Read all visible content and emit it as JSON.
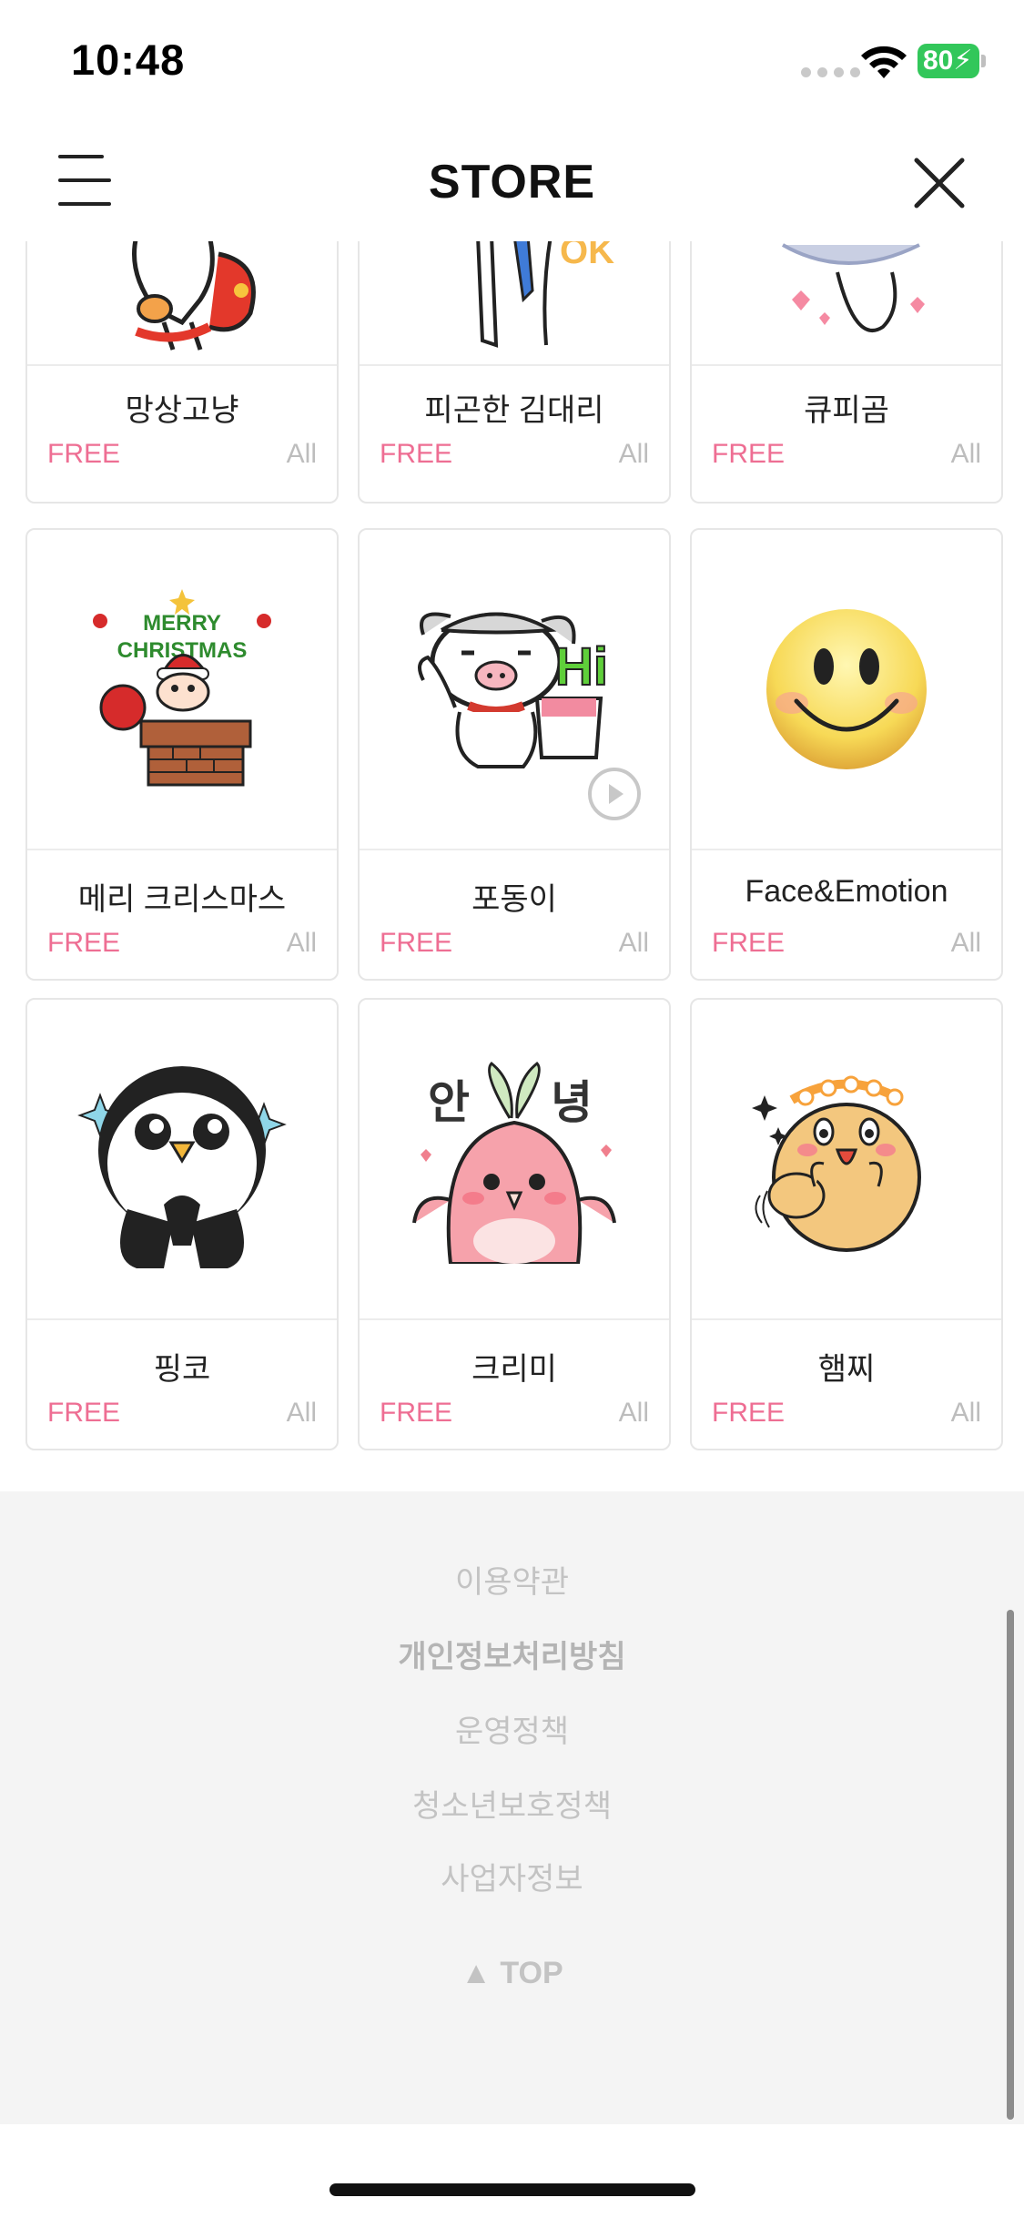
{
  "status_bar": {
    "time": "10:48",
    "battery": "80"
  },
  "header": {
    "title": "STORE",
    "menu_icon": "hamburger-menu-icon",
    "close_icon": "close-icon"
  },
  "stickers": [
    {
      "title": "망상고냥",
      "price": "FREE",
      "age": "All"
    },
    {
      "title": "피곤한 김대리",
      "price": "FREE",
      "age": "All"
    },
    {
      "title": "큐피곰",
      "price": "FREE",
      "age": "All"
    },
    {
      "title": "메리 크리스마스",
      "price": "FREE",
      "age": "All",
      "art_text": [
        "MERRY",
        "CHRISTMAS"
      ]
    },
    {
      "title": "포동이",
      "price": "FREE",
      "age": "All",
      "animated": true,
      "art_text": [
        "Hi"
      ]
    },
    {
      "title": "Face&Emotion",
      "price": "FREE",
      "age": "All"
    },
    {
      "title": "핑코",
      "price": "FREE",
      "age": "All"
    },
    {
      "title": "크리미",
      "price": "FREE",
      "age": "All",
      "art_text": [
        "안",
        "녕"
      ]
    },
    {
      "title": "햄찌",
      "price": "FREE",
      "age": "All"
    }
  ],
  "footer": {
    "links": [
      "이용약관",
      "개인정보처리방침",
      "운영정책",
      "청소년보호정책",
      "사업자정보"
    ],
    "top": "▲ TOP"
  },
  "colors": {
    "price": "#ee6e93",
    "battery": "#32c75a",
    "footer_bg": "#f4f4f4"
  }
}
